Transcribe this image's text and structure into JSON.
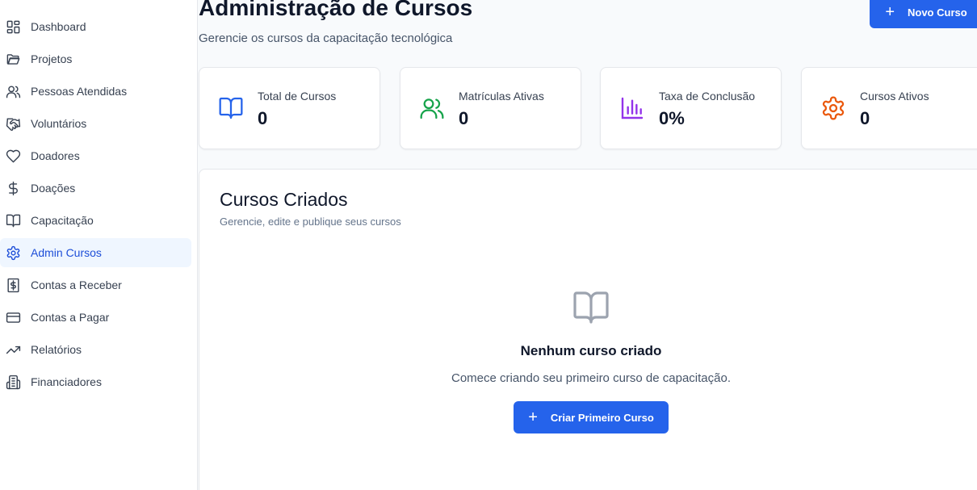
{
  "sidebar": {
    "items": [
      {
        "label": "Dashboard",
        "icon": "dashboard-icon"
      },
      {
        "label": "Projetos",
        "icon": "folder-icon"
      },
      {
        "label": "Pessoas Atendidas",
        "icon": "users-icon"
      },
      {
        "label": "Voluntários",
        "icon": "handshake-icon"
      },
      {
        "label": "Doadores",
        "icon": "heart-icon"
      },
      {
        "label": "Doações",
        "icon": "dollar-icon"
      },
      {
        "label": "Capacitação",
        "icon": "book-icon"
      },
      {
        "label": "Admin Cursos",
        "icon": "gear-icon",
        "active": true
      },
      {
        "label": "Contas a Receber",
        "icon": "receipt-icon"
      },
      {
        "label": "Contas a Pagar",
        "icon": "credit-card-icon"
      },
      {
        "label": "Relatórios",
        "icon": "trending-up-icon"
      },
      {
        "label": "Financiadores",
        "icon": "building-icon"
      }
    ]
  },
  "header": {
    "title": "Administração de Cursos",
    "subtitle": "Gerencie os cursos da capacitação tecnológica",
    "new_course_button": "Novo Curso"
  },
  "stats": [
    {
      "label": "Total de Cursos",
      "value": "0",
      "icon": "book-icon",
      "color": "#2563eb"
    },
    {
      "label": "Matrículas Ativas",
      "value": "0",
      "icon": "users-icon",
      "color": "#16a34a"
    },
    {
      "label": "Taxa de Conclusão",
      "value": "0%",
      "icon": "bar-chart-icon",
      "color": "#9333ea"
    },
    {
      "label": "Cursos Ativos",
      "value": "0",
      "icon": "gear-icon",
      "color": "#ea580c"
    }
  ],
  "courses_panel": {
    "title": "Cursos Criados",
    "subtitle": "Gerencie, edite e publique seus cursos",
    "empty_title": "Nenhum curso criado",
    "empty_description": "Comece criando seu primeiro curso de capacitação.",
    "create_first_button": "Criar Primeiro Curso"
  },
  "colors": {
    "accent": "#2563eb",
    "active_nav_bg": "#eff6ff",
    "active_nav_text": "#1d4ed8"
  }
}
